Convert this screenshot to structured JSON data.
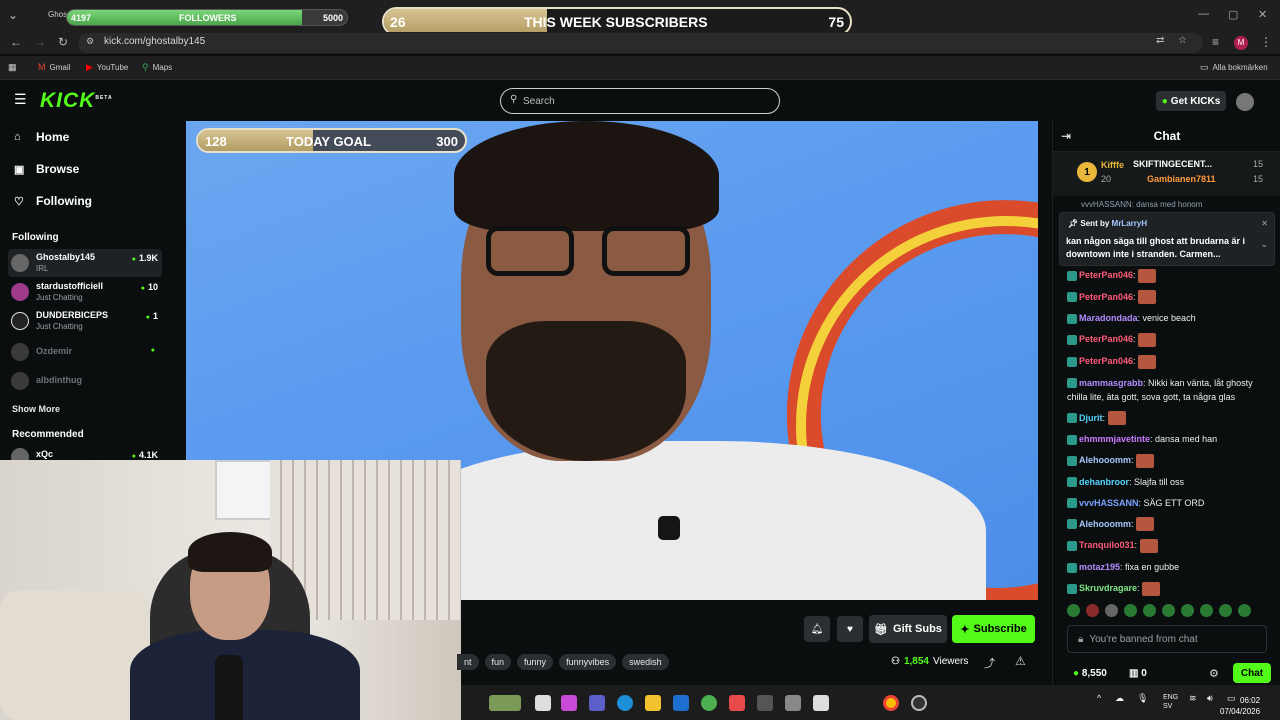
{
  "overlays": {
    "followers": {
      "current": "4197",
      "label": "FOLLOWERS",
      "goal": "5000",
      "progress": 0.84
    },
    "subscribers": {
      "current": "26",
      "label": "THIS WEEK SUBSCRIBERS",
      "goal": "75",
      "progress": 0.35
    },
    "today_goal": {
      "current": "128",
      "label": "TODAY GOAL",
      "goal": "300",
      "progress": 0.43
    }
  },
  "browser": {
    "tab_title": "Ghos",
    "url": "kick.com/ghostalby145",
    "bookmarks": [
      "Gmail",
      "YouTube",
      "Maps"
    ],
    "all_bookmarks": "Alla bokmärken",
    "profile_initial": "M"
  },
  "header": {
    "logo": "KICK",
    "logo_badge": "BETA",
    "search_placeholder": "Search",
    "get_kicks": "Get KICKs"
  },
  "sidebar": {
    "nav": [
      {
        "label": "Home",
        "icon": "home-icon",
        "glyph": "⌂"
      },
      {
        "label": "Browse",
        "icon": "browse-icon",
        "glyph": "▣"
      },
      {
        "label": "Following",
        "icon": "heart-icon",
        "glyph": "♡"
      }
    ],
    "following_heading": "Following",
    "following": [
      {
        "name": "Ghostalby145",
        "sub": "IRL",
        "count": "1.9K",
        "live": true
      },
      {
        "name": "stardustofficiell",
        "sub": "Just Chatting",
        "count": "10",
        "live": true
      },
      {
        "name": "DUNDERBICEPS",
        "sub": "Just Chatting",
        "count": "1",
        "live": true
      },
      {
        "name": "Ozdemir",
        "sub": "",
        "count": "",
        "live": false
      },
      {
        "name": "albdinthug",
        "sub": "",
        "count": "",
        "live": false
      }
    ],
    "show_more": "Show More",
    "recommended_heading": "Recommended",
    "recommended": [
      {
        "name": "xQc",
        "count": "4.1K"
      }
    ]
  },
  "stream": {
    "gift_subs": "Gift Subs",
    "subscribe": "Subscribe",
    "tags": [
      "nt",
      "fun",
      "funny",
      "funnyvibes",
      "swedish"
    ],
    "viewers": "1,854",
    "viewers_label": "Viewers"
  },
  "chat": {
    "title": "Chat",
    "leaderboard": {
      "rank": "1",
      "top_user": "Kifffe",
      "top_user_count": "20",
      "entries": [
        {
          "name": "SKIFTINGECENT...",
          "count": "15"
        },
        {
          "name": "Gambianen7811",
          "count": "15"
        }
      ]
    },
    "clipped_line": "vvvHASSANN: dansa med honom",
    "pinned": {
      "sent_by_label": "Sent by",
      "sent_by": "MrLarryH",
      "message": "kan någon säga till ghost att brudarna är i downtown inte i stranden. Carmen..."
    },
    "messages": [
      {
        "user": "PeterPan046",
        "text": "",
        "color": "#ff5c7a",
        "emote": true
      },
      {
        "user": "PeterPan046",
        "text": "",
        "color": "#ff5c7a",
        "emote": true
      },
      {
        "user": "Maradondada",
        "text": "venice beach",
        "color": "#b48cff",
        "emote": false
      },
      {
        "user": "PeterPan046",
        "text": "",
        "color": "#ff5c7a",
        "emote": true
      },
      {
        "user": "PeterPan046",
        "text": "",
        "color": "#ff5c7a",
        "emote": true
      },
      {
        "user": "mammasgrabb",
        "text": "Nikki kan vänta, låt ghosty chilla lite, äta gott, sova gott, ta några glas",
        "color": "#b48cff",
        "emote": false
      },
      {
        "user": "Djurit",
        "text": "",
        "color": "#55d6ff",
        "emote": true
      },
      {
        "user": "ehmmmjavetinte",
        "text": "dansa med han",
        "color": "#c77dff",
        "emote": false
      },
      {
        "user": "Alehooomm",
        "text": "",
        "color": "#a5c8ff",
        "emote": true
      },
      {
        "user": "dehanbroor",
        "text": "Slajfa till oss",
        "color": "#55d6ff",
        "emote": false
      },
      {
        "user": "vvvHASSANN",
        "text": "SÄG ETT ORD",
        "color": "#7aa2ff",
        "emote": false
      },
      {
        "user": "Alehooomm",
        "text": "",
        "color": "#a5c8ff",
        "emote": true
      },
      {
        "user": "Tranquilo031",
        "text": "",
        "color": "#ff5c7a",
        "emote": true
      },
      {
        "user": "motaz195",
        "text": "fixa en gubbe",
        "color": "#b48cff",
        "emote": false
      },
      {
        "user": "Skruvdragare",
        "text": "",
        "color": "#7ee787",
        "emote": true
      }
    ],
    "banned_text": "You're banned from chat",
    "kicks_balance": "8,550",
    "gift_balance": "0",
    "send_label": "Chat"
  },
  "taskbar": {
    "language": "ENG",
    "layout": "SV",
    "time": "06:02",
    "date": "07/04/2026"
  }
}
